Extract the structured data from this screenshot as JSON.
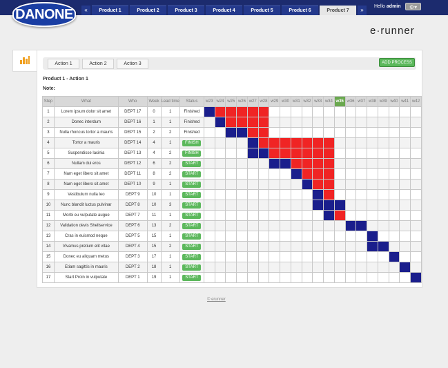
{
  "brand": {
    "logo_text": "DANONE",
    "product_name": "e·runner"
  },
  "nav": {
    "prev": "«",
    "next": "»",
    "tabs": [
      {
        "label": "Product 1",
        "active": false
      },
      {
        "label": "Product 2",
        "active": false
      },
      {
        "label": "Product 3",
        "active": false
      },
      {
        "label": "Product 4",
        "active": false
      },
      {
        "label": "Product 5",
        "active": false
      },
      {
        "label": "Product 6",
        "active": false
      },
      {
        "label": "Product 7",
        "active": true
      }
    ]
  },
  "user": {
    "greeting": "Hello",
    "name": "admin"
  },
  "actions": {
    "tabs": [
      "Action 1",
      "Action 2",
      "Action 3"
    ],
    "add_button": "ADD PROCESS"
  },
  "section": {
    "title": "Product 1 - Action 1",
    "note_label": "Note:"
  },
  "table": {
    "headers": [
      "Step",
      "What",
      "Who",
      "Week",
      "Lead time",
      "Status"
    ],
    "weeks": [
      "w23",
      "w24",
      "w25",
      "w26",
      "w27",
      "w28",
      "w29",
      "w30",
      "w31",
      "w32",
      "w33",
      "w34",
      "w35",
      "w36",
      "w37",
      "w38",
      "w39",
      "w40",
      "w41",
      "w42"
    ],
    "current_week": "w35",
    "rows": [
      {
        "step": "1",
        "what": "Lorem ipsum dolor sit amet",
        "who": "DEPT 17",
        "week": "0",
        "lead": "1",
        "status": "Finished",
        "button": false
      },
      {
        "step": "2",
        "what": "Donec interdum",
        "who": "DEPT 16",
        "week": "1",
        "lead": "1",
        "status": "Finished",
        "button": false
      },
      {
        "step": "3",
        "what": "Nulla rhoncus tortor a mauris",
        "who": "DEPT 15",
        "week": "2",
        "lead": "2",
        "status": "Finished",
        "button": false
      },
      {
        "step": "4",
        "what": "Tortor a mauris",
        "who": "DEPT 14",
        "week": "4",
        "lead": "1",
        "status": "FINISH",
        "button": true
      },
      {
        "step": "5",
        "what": "Suspendisse lacinia",
        "who": "DEPT 13",
        "week": "4",
        "lead": "2",
        "status": "FINISH",
        "button": true
      },
      {
        "step": "6",
        "what": "Nullam dui eros",
        "who": "DEPT 12",
        "week": "6",
        "lead": "2",
        "status": "START",
        "button": true
      },
      {
        "step": "7",
        "what": "Nam eget libero sit amet",
        "who": "DEPT 11",
        "week": "8",
        "lead": "2",
        "status": "START",
        "button": true
      },
      {
        "step": "8",
        "what": "Nam eget libero sit amet",
        "who": "DEPT 10",
        "week": "9",
        "lead": "1",
        "status": "START",
        "button": true
      },
      {
        "step": "9",
        "what": "Vestibulum nulla leo",
        "who": "DEPT 9",
        "week": "10",
        "lead": "1",
        "status": "START",
        "button": true
      },
      {
        "step": "10",
        "what": "Nunc blandit luctus pulvinar",
        "who": "DEPT 8",
        "week": "10",
        "lead": "3",
        "status": "START",
        "button": true
      },
      {
        "step": "11",
        "what": "Morbi eu vulputate augue",
        "who": "DEPT 7",
        "week": "11",
        "lead": "1",
        "status": "START",
        "button": true
      },
      {
        "step": "12",
        "what": "Validation devis Shellservice",
        "who": "DEPT 6",
        "week": "13",
        "lead": "2",
        "status": "START",
        "button": true
      },
      {
        "step": "13",
        "what": "Cras in euismod neque",
        "who": "DEPT 5",
        "week": "15",
        "lead": "1",
        "status": "START",
        "button": true
      },
      {
        "step": "14",
        "what": "Vivamus pretium elit vitae",
        "who": "DEPT 4",
        "week": "15",
        "lead": "2",
        "status": "START",
        "button": true
      },
      {
        "step": "15",
        "what": "Donec eu aliquam metus",
        "who": "DEPT 3",
        "week": "17",
        "lead": "1",
        "status": "START",
        "button": true
      },
      {
        "step": "16",
        "what": "Etiam sagittis in mauris",
        "who": "DEPT 2",
        "week": "18",
        "lead": "1",
        "status": "START",
        "button": true
      },
      {
        "step": "17",
        "what": "Start Proin in vulputate",
        "who": "DEPT 1",
        "week": "19",
        "lead": "1",
        "status": "START",
        "button": true
      }
    ],
    "gantt": [
      "BRRRRR..............",
      ".BRRRR..............",
      "..BBRR..............",
      "....BRRRRRRR........",
      "....BBRRRRRR........",
      "......BBRRRR........",
      "........BRRR........",
      ".........BRR........",
      "..........BR........",
      "..........BBB.......",
      "...........BR.......",
      ".............BB.....",
      "...............B....",
      "...............BB...",
      ".................B..",
      "..................B.",
      "...................B"
    ]
  },
  "colors": {
    "planned": "#1a1e8c",
    "late": "#f02424",
    "accent": "#5cb85c",
    "nav": "#24398c"
  },
  "footer": {
    "link": "© erunner"
  }
}
